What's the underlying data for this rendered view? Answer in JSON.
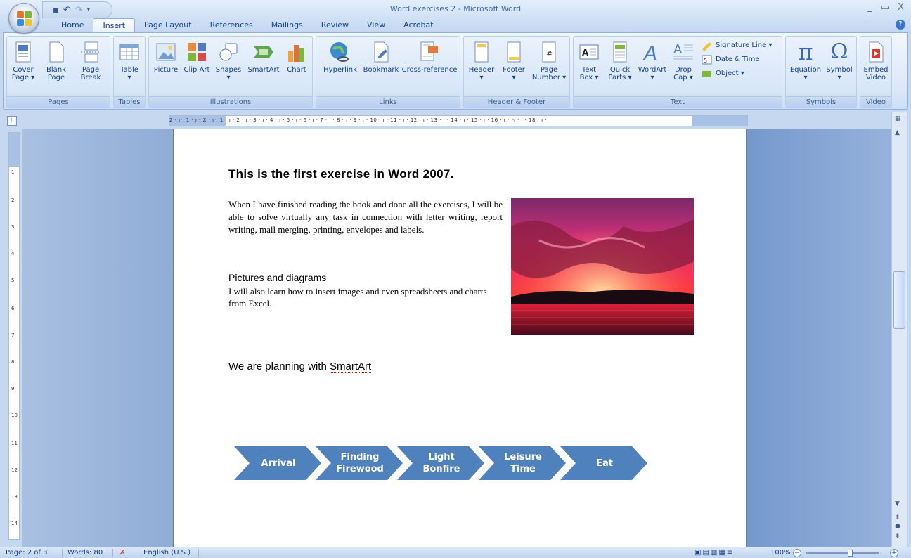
{
  "window": {
    "title": "Word exercises 2 - Microsoft Word",
    "controls": [
      "_",
      "▭",
      "X"
    ]
  },
  "tabs": [
    {
      "label": "Home"
    },
    {
      "label": "Insert",
      "active": true
    },
    {
      "label": "Page Layout"
    },
    {
      "label": "References"
    },
    {
      "label": "Mailings"
    },
    {
      "label": "Review"
    },
    {
      "label": "View"
    },
    {
      "label": "Acrobat"
    }
  ],
  "ribbon": {
    "pages": {
      "label": "Pages",
      "cover": "Cover Page ▾",
      "blank": "Blank Page",
      "break": "Page Break"
    },
    "tables": {
      "label": "Tables",
      "table": "Table"
    },
    "illustrations": {
      "label": "Illustrations",
      "picture": "Picture",
      "clipart": "Clip Art",
      "shapes": "Shapes",
      "smartart": "SmartArt",
      "chart": "Chart"
    },
    "links": {
      "label": "Links",
      "hyperlink": "Hyperlink",
      "bookmark": "Bookmark",
      "crossref": "Cross-reference"
    },
    "headerfooter": {
      "label": "Header & Footer",
      "header": "Header",
      "footer": "Footer",
      "pagenum": "Page Number ▾"
    },
    "text": {
      "label": "Text",
      "textbox": "Text Box ▾",
      "quickparts": "Quick Parts ▾",
      "wordart": "WordArt",
      "dropcap": "Drop Cap ▾",
      "sigline": "Signature Line ▾",
      "datetime": "Date & Time",
      "object": "Object ▾"
    },
    "symbols": {
      "label": "Symbols",
      "equation": "Equation",
      "symbol": "Symbol"
    },
    "video": {
      "label": "Video",
      "embed": "Embed Video"
    }
  },
  "ruler": {
    "ticks": "2 · ı · 1 · ı · ⧖ · ı · 1 · ı · 2 · ı · 3 · ı · 4 · ı · 5 · ı · 6 · ı · 7 · ı · 8 · ı · 9 · ı · 10 · ı · 11 · ı · 12 · ı · 13 · ı · 14 · ı · 15 · ı · 16 · ı · △ · ı · 18 · ı ·",
    "vnums": [
      "1",
      "2",
      "3",
      "4",
      "5",
      "6",
      "7",
      "8",
      "9",
      "10",
      "11",
      "12",
      "13",
      "14"
    ]
  },
  "document": {
    "heading": "This is the first  exercise in Word 2007.",
    "para1": "When I have finished reading the book and done all the exercises, I will be able to solve virtually any task in connection with letter writing, report writing, mail merging, printing, envelopes and labels.",
    "heading2": "Pictures and diagrams",
    "para2": "I will  also learn how to insert images and even spreadsheets and charts from Excel.",
    "heading3_a": "We are planning  with ",
    "heading3_b": "SmartArt",
    "smartart": {
      "color": "#4f81bd",
      "steps": [
        {
          "l1": "Arrival",
          "l2": ""
        },
        {
          "l1": "Finding",
          "l2": "Firewood"
        },
        {
          "l1": "Light",
          "l2": "Bonfire"
        },
        {
          "l1": "Leisure",
          "l2": "Time"
        },
        {
          "l1": "Eat",
          "l2": ""
        }
      ]
    }
  },
  "status": {
    "page": "Page: 2 of 3",
    "words": "Words: 80",
    "lang": "English (U.S.)",
    "zoom": "100%"
  }
}
